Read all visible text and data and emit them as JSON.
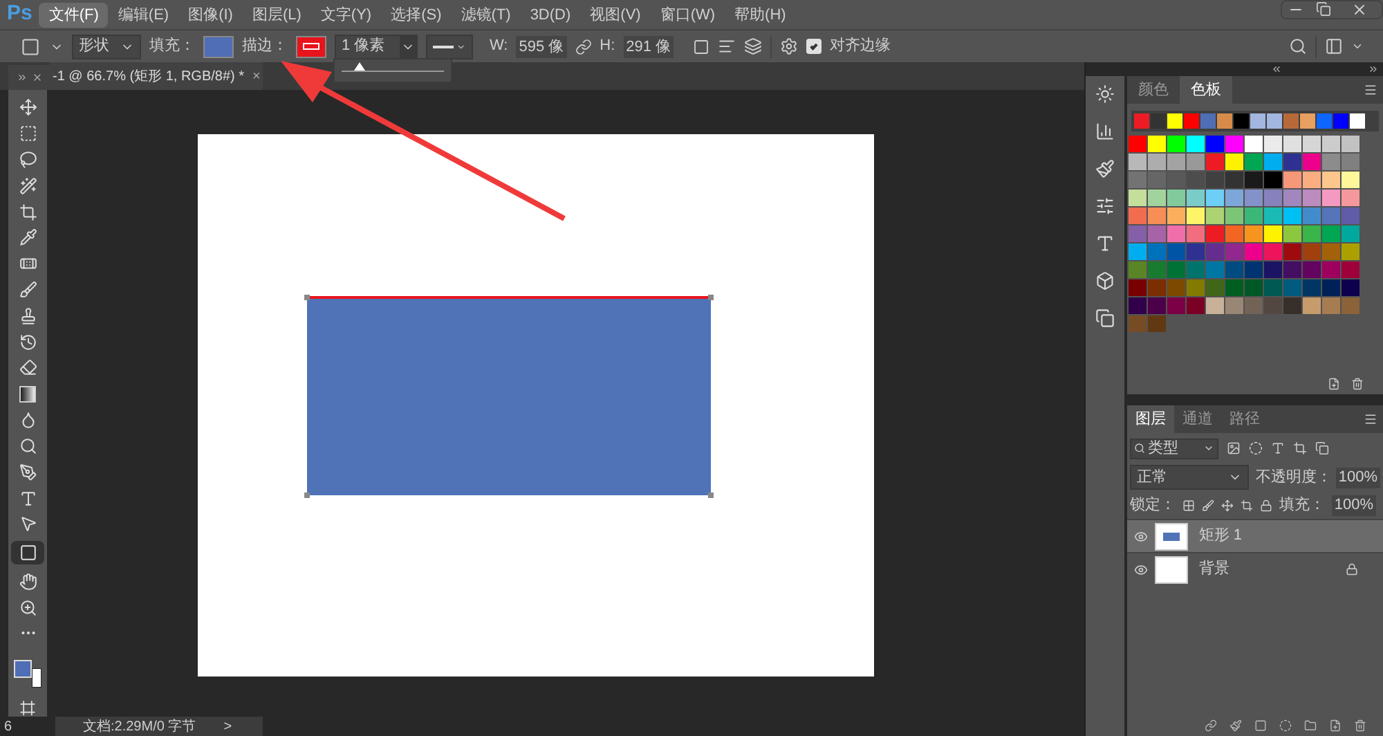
{
  "logo": "Ps",
  "menu": [
    {
      "label": "文件(F)",
      "selected": true
    },
    {
      "label": "编辑(E)",
      "selected": false
    },
    {
      "label": "图像(I)",
      "selected": false
    },
    {
      "label": "图层(L)",
      "selected": false
    },
    {
      "label": "文字(Y)",
      "selected": false
    },
    {
      "label": "选择(S)",
      "selected": false
    },
    {
      "label": "滤镜(T)",
      "selected": false
    },
    {
      "label": "3D(D)",
      "selected": false
    },
    {
      "label": "视图(V)",
      "selected": false
    },
    {
      "label": "窗口(W)",
      "selected": false
    },
    {
      "label": "帮助(H)",
      "selected": false
    }
  ],
  "options": {
    "mode": "形状",
    "fill_label": "填充：",
    "stroke_label": "描边：",
    "stroke_width": "1 像素",
    "stroke_width_slider": {
      "level": 0.18
    },
    "w_label": "W:",
    "w_value": "595 像",
    "h_label": "H:",
    "h_value": "291 像",
    "align_edges": {
      "label": "对齐边缘",
      "checked": true
    }
  },
  "document_tab": {
    "title": "-1 @ 66.7% (矩形 1, RGB/8#) *",
    "close": "×"
  },
  "tools": [
    {
      "selected": false
    },
    {
      "selected": false
    },
    {
      "selected": false
    },
    {
      "selected": false
    },
    {
      "selected": false
    },
    {
      "selected": false
    },
    {
      "selected": false
    },
    {
      "selected": false
    },
    {
      "selected": false
    },
    {
      "selected": false
    },
    {
      "selected": false
    },
    {
      "selected": false
    },
    {
      "selected": false
    },
    {
      "selected": false
    },
    {
      "selected": false
    },
    {
      "selected": false
    },
    {
      "selected": false
    },
    {
      "selected": true
    },
    {
      "selected": false
    },
    {
      "selected": false
    },
    {
      "selected": false
    }
  ],
  "status_bar": {
    "zoom": "6",
    "doc_info": "文档:2.29M/0 字节",
    "more": ">"
  },
  "swatches_panel": {
    "tabs": [
      {
        "label": "颜色",
        "selected": false
      },
      {
        "label": "色板",
        "selected": true
      }
    ],
    "recent": [
      {
        "color": "#ed1c24"
      },
      {
        "color": "#333333"
      },
      {
        "color": "#ffff00"
      },
      {
        "color": "#ff0000"
      },
      {
        "color": "#4f6eb5"
      },
      {
        "color": "#d68b4a"
      },
      {
        "color": "#000000"
      },
      {
        "color": "#a3b6e0"
      },
      {
        "color": "#a3b6e0"
      },
      {
        "color": "#b8693a"
      },
      {
        "color": "#e8a060"
      },
      {
        "color": "#0d66ff"
      },
      {
        "color": "#0000ff"
      },
      {
        "color": "#ffffff"
      }
    ],
    "swatches": [
      {
        "color": "#ff0000"
      },
      {
        "color": "#ffff00"
      },
      {
        "color": "#00ff00"
      },
      {
        "color": "#00ffff"
      },
      {
        "color": "#0000ff"
      },
      {
        "color": "#ff00ff"
      },
      {
        "color": "#ffffff"
      },
      {
        "color": "#ebebeb"
      },
      {
        "color": "#e0e0e0"
      },
      {
        "color": "#d6d6d6"
      },
      {
        "color": "#cccccc"
      },
      {
        "color": "#c2c2c2"
      },
      {
        "color": "#b8b8b8"
      },
      {
        "color": "#adadad"
      },
      {
        "color": "#a3a3a3"
      },
      {
        "color": "#999999"
      },
      {
        "color": "#ed1c24"
      },
      {
        "color": "#fff200"
      },
      {
        "color": "#00a651"
      },
      {
        "color": "#00aeef"
      },
      {
        "color": "#2e3192"
      },
      {
        "color": "#ec008c"
      },
      {
        "color": "#8c8c8c"
      },
      {
        "color": "#808080"
      },
      {
        "color": "#737373"
      },
      {
        "color": "#666666"
      },
      {
        "color": "#595959"
      },
      {
        "color": "#4d4d4d"
      },
      {
        "color": "#404040"
      },
      {
        "color": "#333333"
      },
      {
        "color": "#1a1a1a"
      },
      {
        "color": "#000000"
      },
      {
        "color": "#f7977a"
      },
      {
        "color": "#fbad82"
      },
      {
        "color": "#fdc68c"
      },
      {
        "color": "#fff799"
      },
      {
        "color": "#c4df9b"
      },
      {
        "color": "#a3d39c"
      },
      {
        "color": "#82ca9c"
      },
      {
        "color": "#7accc8"
      },
      {
        "color": "#6dcff6"
      },
      {
        "color": "#7da7d9"
      },
      {
        "color": "#8393ca"
      },
      {
        "color": "#8781bd"
      },
      {
        "color": "#a187be"
      },
      {
        "color": "#bd8cbf"
      },
      {
        "color": "#f49ac1"
      },
      {
        "color": "#f5989d"
      },
      {
        "color": "#f26c4f"
      },
      {
        "color": "#f68e56"
      },
      {
        "color": "#fbaf5d"
      },
      {
        "color": "#fff467"
      },
      {
        "color": "#acd372"
      },
      {
        "color": "#7cc576"
      },
      {
        "color": "#3bb878"
      },
      {
        "color": "#1abbb4"
      },
      {
        "color": "#00bff3"
      },
      {
        "color": "#438ccb"
      },
      {
        "color": "#5574b9"
      },
      {
        "color": "#605ca8"
      },
      {
        "color": "#855fa8"
      },
      {
        "color": "#a763a8"
      },
      {
        "color": "#f06eaa"
      },
      {
        "color": "#f26d7d"
      },
      {
        "color": "#ed1c24"
      },
      {
        "color": "#f26522"
      },
      {
        "color": "#f7941d"
      },
      {
        "color": "#fff200"
      },
      {
        "color": "#8dc63f"
      },
      {
        "color": "#39b54a"
      },
      {
        "color": "#00a651"
      },
      {
        "color": "#00a99d"
      },
      {
        "color": "#00aeef"
      },
      {
        "color": "#0072bc"
      },
      {
        "color": "#0054a6"
      },
      {
        "color": "#2e3192"
      },
      {
        "color": "#662d91"
      },
      {
        "color": "#92278f"
      },
      {
        "color": "#ec008c"
      },
      {
        "color": "#ed145b"
      },
      {
        "color": "#9e0b0f"
      },
      {
        "color": "#a0410d"
      },
      {
        "color": "#a36209"
      },
      {
        "color": "#aba000"
      },
      {
        "color": "#598527"
      },
      {
        "color": "#197b30"
      },
      {
        "color": "#007236"
      },
      {
        "color": "#00746b"
      },
      {
        "color": "#0076a3"
      },
      {
        "color": "#004b80"
      },
      {
        "color": "#003471"
      },
      {
        "color": "#1b1464"
      },
      {
        "color": "#440e62"
      },
      {
        "color": "#630460"
      },
      {
        "color": "#9e005d"
      },
      {
        "color": "#9e0039"
      },
      {
        "color": "#790000"
      },
      {
        "color": "#7b2e00"
      },
      {
        "color": "#7d4900"
      },
      {
        "color": "#827b00"
      },
      {
        "color": "#406618"
      },
      {
        "color": "#005e20"
      },
      {
        "color": "#005826"
      },
      {
        "color": "#005952"
      },
      {
        "color": "#005b7f"
      },
      {
        "color": "#003663"
      },
      {
        "color": "#002157"
      },
      {
        "color": "#0d004c"
      },
      {
        "color": "#32004b"
      },
      {
        "color": "#4b0049"
      },
      {
        "color": "#7b0046"
      },
      {
        "color": "#7a0026"
      },
      {
        "color": "#c7b299"
      },
      {
        "color": "#998675"
      },
      {
        "color": "#736357"
      },
      {
        "color": "#534741"
      },
      {
        "color": "#37302a"
      },
      {
        "color": "#c69c6d"
      },
      {
        "color": "#a67c52"
      },
      {
        "color": "#8c6239"
      },
      {
        "color": "#754c24"
      },
      {
        "color": "#603913"
      }
    ]
  },
  "layers_panel": {
    "tabs": [
      {
        "label": "图层",
        "selected": true
      },
      {
        "label": "通道",
        "selected": false
      },
      {
        "label": "路径",
        "selected": false
      }
    ],
    "filter": "类型",
    "blend_mode": "正常",
    "opacity_label": "不透明度：",
    "opacity": "100%",
    "lock_label": "锁定：",
    "fill_label": "填充：",
    "fill": "100%",
    "layers": [
      {
        "name": "矩形 1",
        "kind": "shape",
        "selected": true,
        "visible": true,
        "locked": false
      },
      {
        "name": "背景",
        "kind": "background",
        "selected": false,
        "visible": true,
        "locked": true
      }
    ]
  }
}
